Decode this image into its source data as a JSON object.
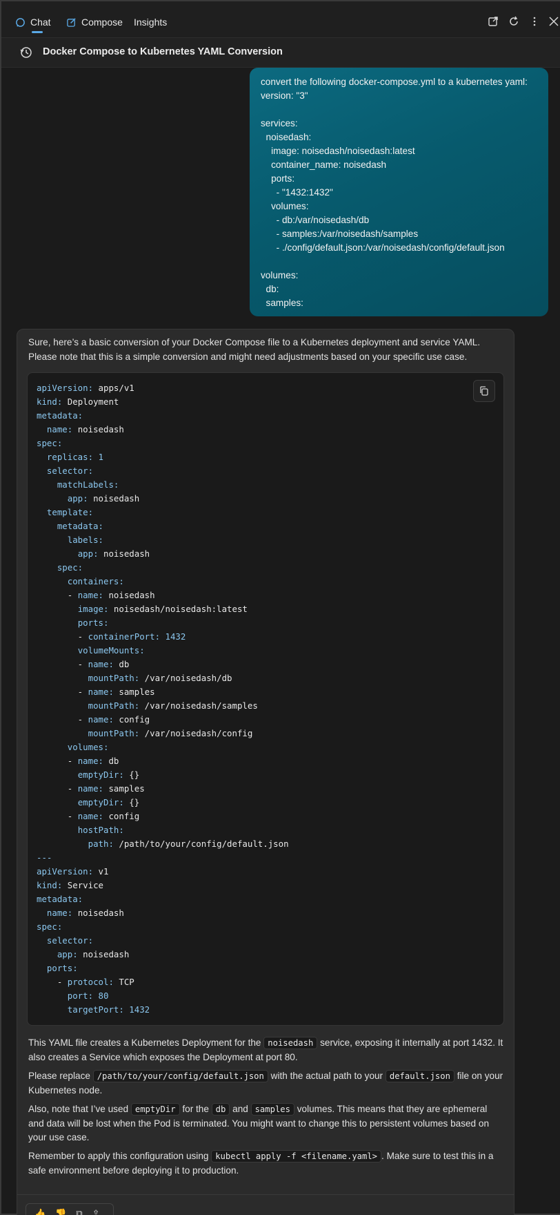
{
  "tabs": {
    "chat": "Chat",
    "compose": "Compose",
    "insights": "Insights"
  },
  "toolbar": {
    "icons": [
      "open-external-icon",
      "refresh-icon",
      "more-vertical-icon",
      "close-icon"
    ]
  },
  "conversation": {
    "title": "Docker Compose to Kubernetes YAML Conversion"
  },
  "user_message": {
    "lines": [
      "convert the following docker-compose.yml to a kubernetes yaml:",
      "version: \"3\"",
      "",
      "services:",
      "  noisedash:",
      "    image: noisedash/noisedash:latest",
      "    container_name: noisedash",
      "    ports:",
      "      - \"1432:1432\"",
      "    volumes:",
      "      - db:/var/noisedash/db",
      "      - samples:/var/noisedash/samples",
      "      - ./config/default.json:/var/noisedash/config/default.json",
      "",
      "volumes:",
      "  db:",
      "  samples:"
    ]
  },
  "assistant": {
    "intro": "Sure, here’s a basic conversion of your Docker Compose file to a Kubernetes deployment and service YAML. Please note that this is a simple conversion and might need adjustments based on your specific use case.",
    "code_lines": [
      "apiVersion: apps/v1",
      "kind: Deployment",
      "metadata:",
      "  name: noisedash",
      "spec:",
      "  replicas: 1",
      "  selector:",
      "    matchLabels:",
      "      app: noisedash",
      "  template:",
      "    metadata:",
      "      labels:",
      "        app: noisedash",
      "    spec:",
      "      containers:",
      "      - name: noisedash",
      "        image: noisedash/noisedash:latest",
      "        ports:",
      "        - containerPort: 1432",
      "        volumeMounts:",
      "        - name: db",
      "          mountPath: /var/noisedash/db",
      "        - name: samples",
      "          mountPath: /var/noisedash/samples",
      "        - name: config",
      "          mountPath: /var/noisedash/config",
      "      volumes:",
      "      - name: db",
      "        emptyDir: {}",
      "      - name: samples",
      "        emptyDir: {}",
      "      - name: config",
      "        hostPath:",
      "          path: /path/to/your/config/default.json",
      "---",
      "apiVersion: v1",
      "kind: Service",
      "metadata:",
      "  name: noisedash",
      "spec:",
      "  selector:",
      "    app: noisedash",
      "  ports:",
      "    - protocol: TCP",
      "      port: 80",
      "      targetPort: 1432"
    ],
    "p1": {
      "a": "This YAML file creates a Kubernetes Deployment for the ",
      "code": "noisedash",
      "b": " service, exposing it internally at port 1432. It also creates a Service which exposes the Deployment at port 80."
    },
    "p2": {
      "a": "Please replace ",
      "code1": "/path/to/your/config/default.json",
      "b": " with the actual path to your ",
      "code2": "default.json",
      "c": " file on your Kubernetes node."
    },
    "p3": {
      "a": "Also, note that I’ve used ",
      "code1": "emptyDir",
      "b": " for the ",
      "code2": "db",
      "c": " and ",
      "code3": "samples",
      "d": " volumes. This means that they are ephemeral and data will be lost when the Pod is terminated. You might want to change this to persistent volumes based on your use case."
    },
    "p4": {
      "a": "Remember to apply this configuration using ",
      "code": "kubectl apply -f <filename.yaml>",
      "b": ". Make sure to test this in a safe environment before deploying it to production."
    }
  },
  "colors": {
    "user_bubble": "#0a6175",
    "code_key": "#8cc8f0",
    "accent": "#5aa9e6"
  }
}
